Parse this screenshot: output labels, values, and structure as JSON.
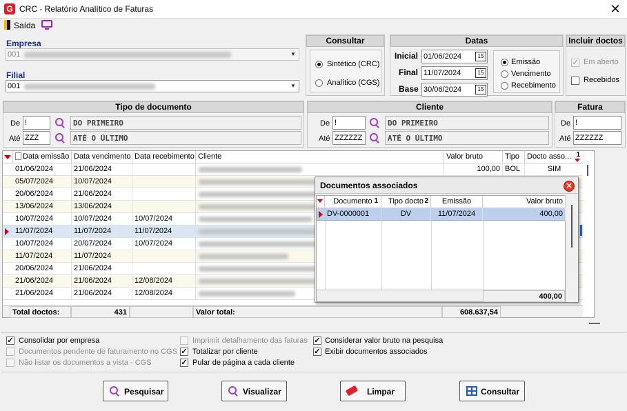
{
  "window": {
    "title": "CRC - Relatório Analítico de Faturas",
    "close": "✕"
  },
  "menu": {
    "exit_label": "Saída"
  },
  "empresa": {
    "label": "Empresa",
    "code": "001"
  },
  "filial": {
    "label": "Filial",
    "code": "001"
  },
  "consultar": {
    "title": "Consultar",
    "option_sintetico": "Sintético (CRC)",
    "option_analitico": "Analítico (CGS)",
    "selected": "Sintético (CRC)"
  },
  "datas": {
    "title": "Datas",
    "inicial_label": "Inicial",
    "inicial_value": "01/06/2024",
    "final_label": "Final",
    "final_value": "11/07/2024",
    "base_label": "Base",
    "base_value": "30/06/2024",
    "opt_emissao": "Emissão",
    "opt_vencimento": "Vencimento",
    "opt_recebimento": "Recebimento",
    "selected": "Emissão",
    "cal_icon": "15"
  },
  "incluir": {
    "title": "Incluir doctos",
    "em_aberto": "Em aberto",
    "recebidos": "Recebidos"
  },
  "tipo_documento": {
    "title": "Tipo de documento",
    "de_label": "De",
    "de_value": "!",
    "ate_label": "Até",
    "ate_value": "ZZZ",
    "de_text": "DO PRIMEIRO",
    "ate_text": "ATÉ O ÚLTIMO"
  },
  "cliente": {
    "title": "Cliente",
    "de_label": "De",
    "de_value": "!",
    "ate_label": "Até",
    "ate_value": "ZZZZZZ",
    "de_text": "DO PRIMEIRO",
    "ate_text": "ATÉ O ÚLTIMO"
  },
  "fatura": {
    "title": "Fatura",
    "de_label": "De",
    "de_value": "!",
    "ate_label": "Até",
    "ate_value": "ZZZZZZ"
  },
  "grid": {
    "columns": [
      "Data emissão",
      "Data vencimento",
      "Data recebimento",
      "Cliente",
      "Valor bruto",
      "Tipo",
      "Docto asso..."
    ],
    "sort_badge": "1",
    "rows": [
      {
        "emissao": "01/06/2024",
        "vencimento": "21/06/2024",
        "recebimento": "",
        "valor": "100,00",
        "tipo": "BOL",
        "docto": "SIM"
      },
      {
        "emissao": "05/07/2024",
        "vencimento": "10/07/2024",
        "recebimento": "",
        "valor": "",
        "tipo": "",
        "docto": ""
      },
      {
        "emissao": "20/06/2024",
        "vencimento": "21/06/2024",
        "recebimento": "",
        "valor": "",
        "tipo": "",
        "docto": ""
      },
      {
        "emissao": "13/06/2024",
        "vencimento": "13/06/2024",
        "recebimento": "",
        "valor": "",
        "tipo": "",
        "docto": ""
      },
      {
        "emissao": "10/07/2024",
        "vencimento": "10/07/2024",
        "recebimento": "10/07/2024",
        "valor": "",
        "tipo": "",
        "docto": ""
      },
      {
        "emissao": "11/07/2024",
        "vencimento": "11/07/2024",
        "recebimento": "11/07/2024",
        "valor": "",
        "tipo": "",
        "docto": ""
      },
      {
        "emissao": "10/07/2024",
        "vencimento": "20/07/2024",
        "recebimento": "10/07/2024",
        "valor": "",
        "tipo": "",
        "docto": ""
      },
      {
        "emissao": "11/07/2024",
        "vencimento": "11/07/2024",
        "recebimento": "",
        "valor": "",
        "tipo": "",
        "docto": ""
      },
      {
        "emissao": "20/06/2024",
        "vencimento": "21/06/2024",
        "recebimento": "",
        "valor": "",
        "tipo": "",
        "docto": ""
      },
      {
        "emissao": "21/06/2024",
        "vencimento": "21/06/2024",
        "recebimento": "12/08/2024",
        "valor": "",
        "tipo": "",
        "docto": ""
      },
      {
        "emissao": "21/06/2024",
        "vencimento": "21/06/2024",
        "recebimento": "12/08/2024",
        "valor": "",
        "tipo": "",
        "docto": ""
      }
    ],
    "selected_row": 5,
    "footer": {
      "total_doctos_label": "Total doctos:",
      "total_doctos_value": "431",
      "valor_total_label": "Valor total:",
      "valor_total_value": "608.637,54"
    }
  },
  "popup": {
    "title": "Documentos associados",
    "columns": [
      "Documento",
      "Tipo docto",
      "Emissão",
      "Valor bruto"
    ],
    "badge_doc": "1",
    "badge_tipo": "2",
    "rows": [
      {
        "documento": "DV-0000001",
        "tipo": "DV",
        "emissao": "11/07/2024",
        "valor": "400,00"
      }
    ],
    "total": "400,00"
  },
  "options": {
    "consolidar": "Consolidar por empresa",
    "pendente": "Documentos pendente de faturamento no CGS",
    "nao_listar": "Não listar os documentos a vista - CGS",
    "imprimir": "Imprimir detalhamento das faturas",
    "totalizar": "Totalizar por cliente",
    "pular": "Pular de página a cada cliente",
    "considerar": "Considerar valor bruto na pesquisa",
    "exibir": "Exibir documentos associados"
  },
  "buttons": {
    "pesquisar": "Pesquisar",
    "visualizar": "Visualizar",
    "limpar": "Limpar",
    "consultar": "Consultar"
  },
  "colors": {
    "accent_red": "#d00000",
    "magnifier": "#a040c0",
    "selected_row": "#dbe6f4"
  }
}
